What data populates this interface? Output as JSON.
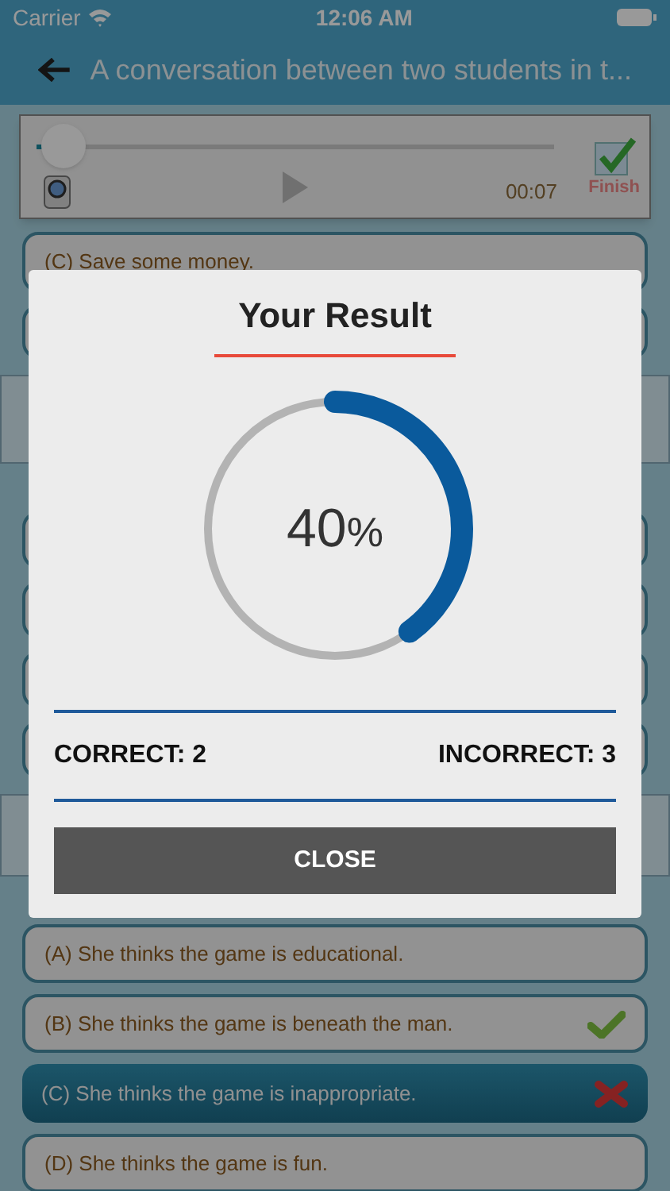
{
  "status_bar": {
    "carrier": "Carrier",
    "time": "12:06 AM"
  },
  "header": {
    "title": "A conversation between two students in t..."
  },
  "player": {
    "level": 0.02,
    "time": "00:07",
    "finish_label": "Finish"
  },
  "top_options": [
    {
      "text": "(C) Save some money."
    }
  ],
  "bottom_options": [
    {
      "text": "(A) She thinks the game is educational.",
      "selected": false,
      "kind": "plain"
    },
    {
      "text": "(B) She thinks the game is beneath the man.",
      "selected": false,
      "kind": "correct"
    },
    {
      "text": "(C) She thinks the game is inappropriate.",
      "selected": true,
      "kind": "wrong"
    },
    {
      "text": "(D) She thinks the game is fun.",
      "selected": false,
      "kind": "plain"
    }
  ],
  "result_dialog": {
    "title": "Your Result",
    "level": 0.4,
    "percent": "40",
    "percent_sign": "%",
    "correct": "CORRECT: 2",
    "incorrect": "INCORRECT: 3",
    "close_button": "CLOSE"
  }
}
